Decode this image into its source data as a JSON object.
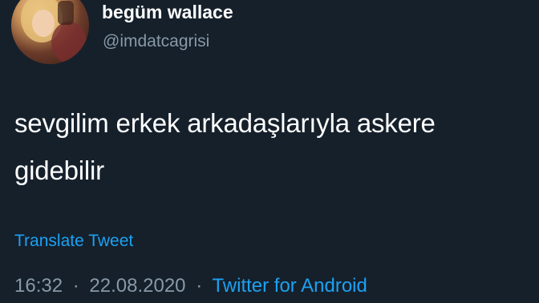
{
  "author": {
    "display_name": "begüm wallace",
    "handle": "@imdatcagrisi"
  },
  "tweet": {
    "text_line1": "sevgilim erkek arkadaşlarıyla askere",
    "text_line2": "gidebilir",
    "translate_label": "Translate Tweet"
  },
  "meta": {
    "time": "16:32",
    "separator": "·",
    "date": "22.08.2020",
    "source": "Twitter for Android"
  },
  "colors": {
    "background": "#15202b",
    "text": "#ffffff",
    "secondary": "#8899a6",
    "accent": "#1da1f2"
  }
}
